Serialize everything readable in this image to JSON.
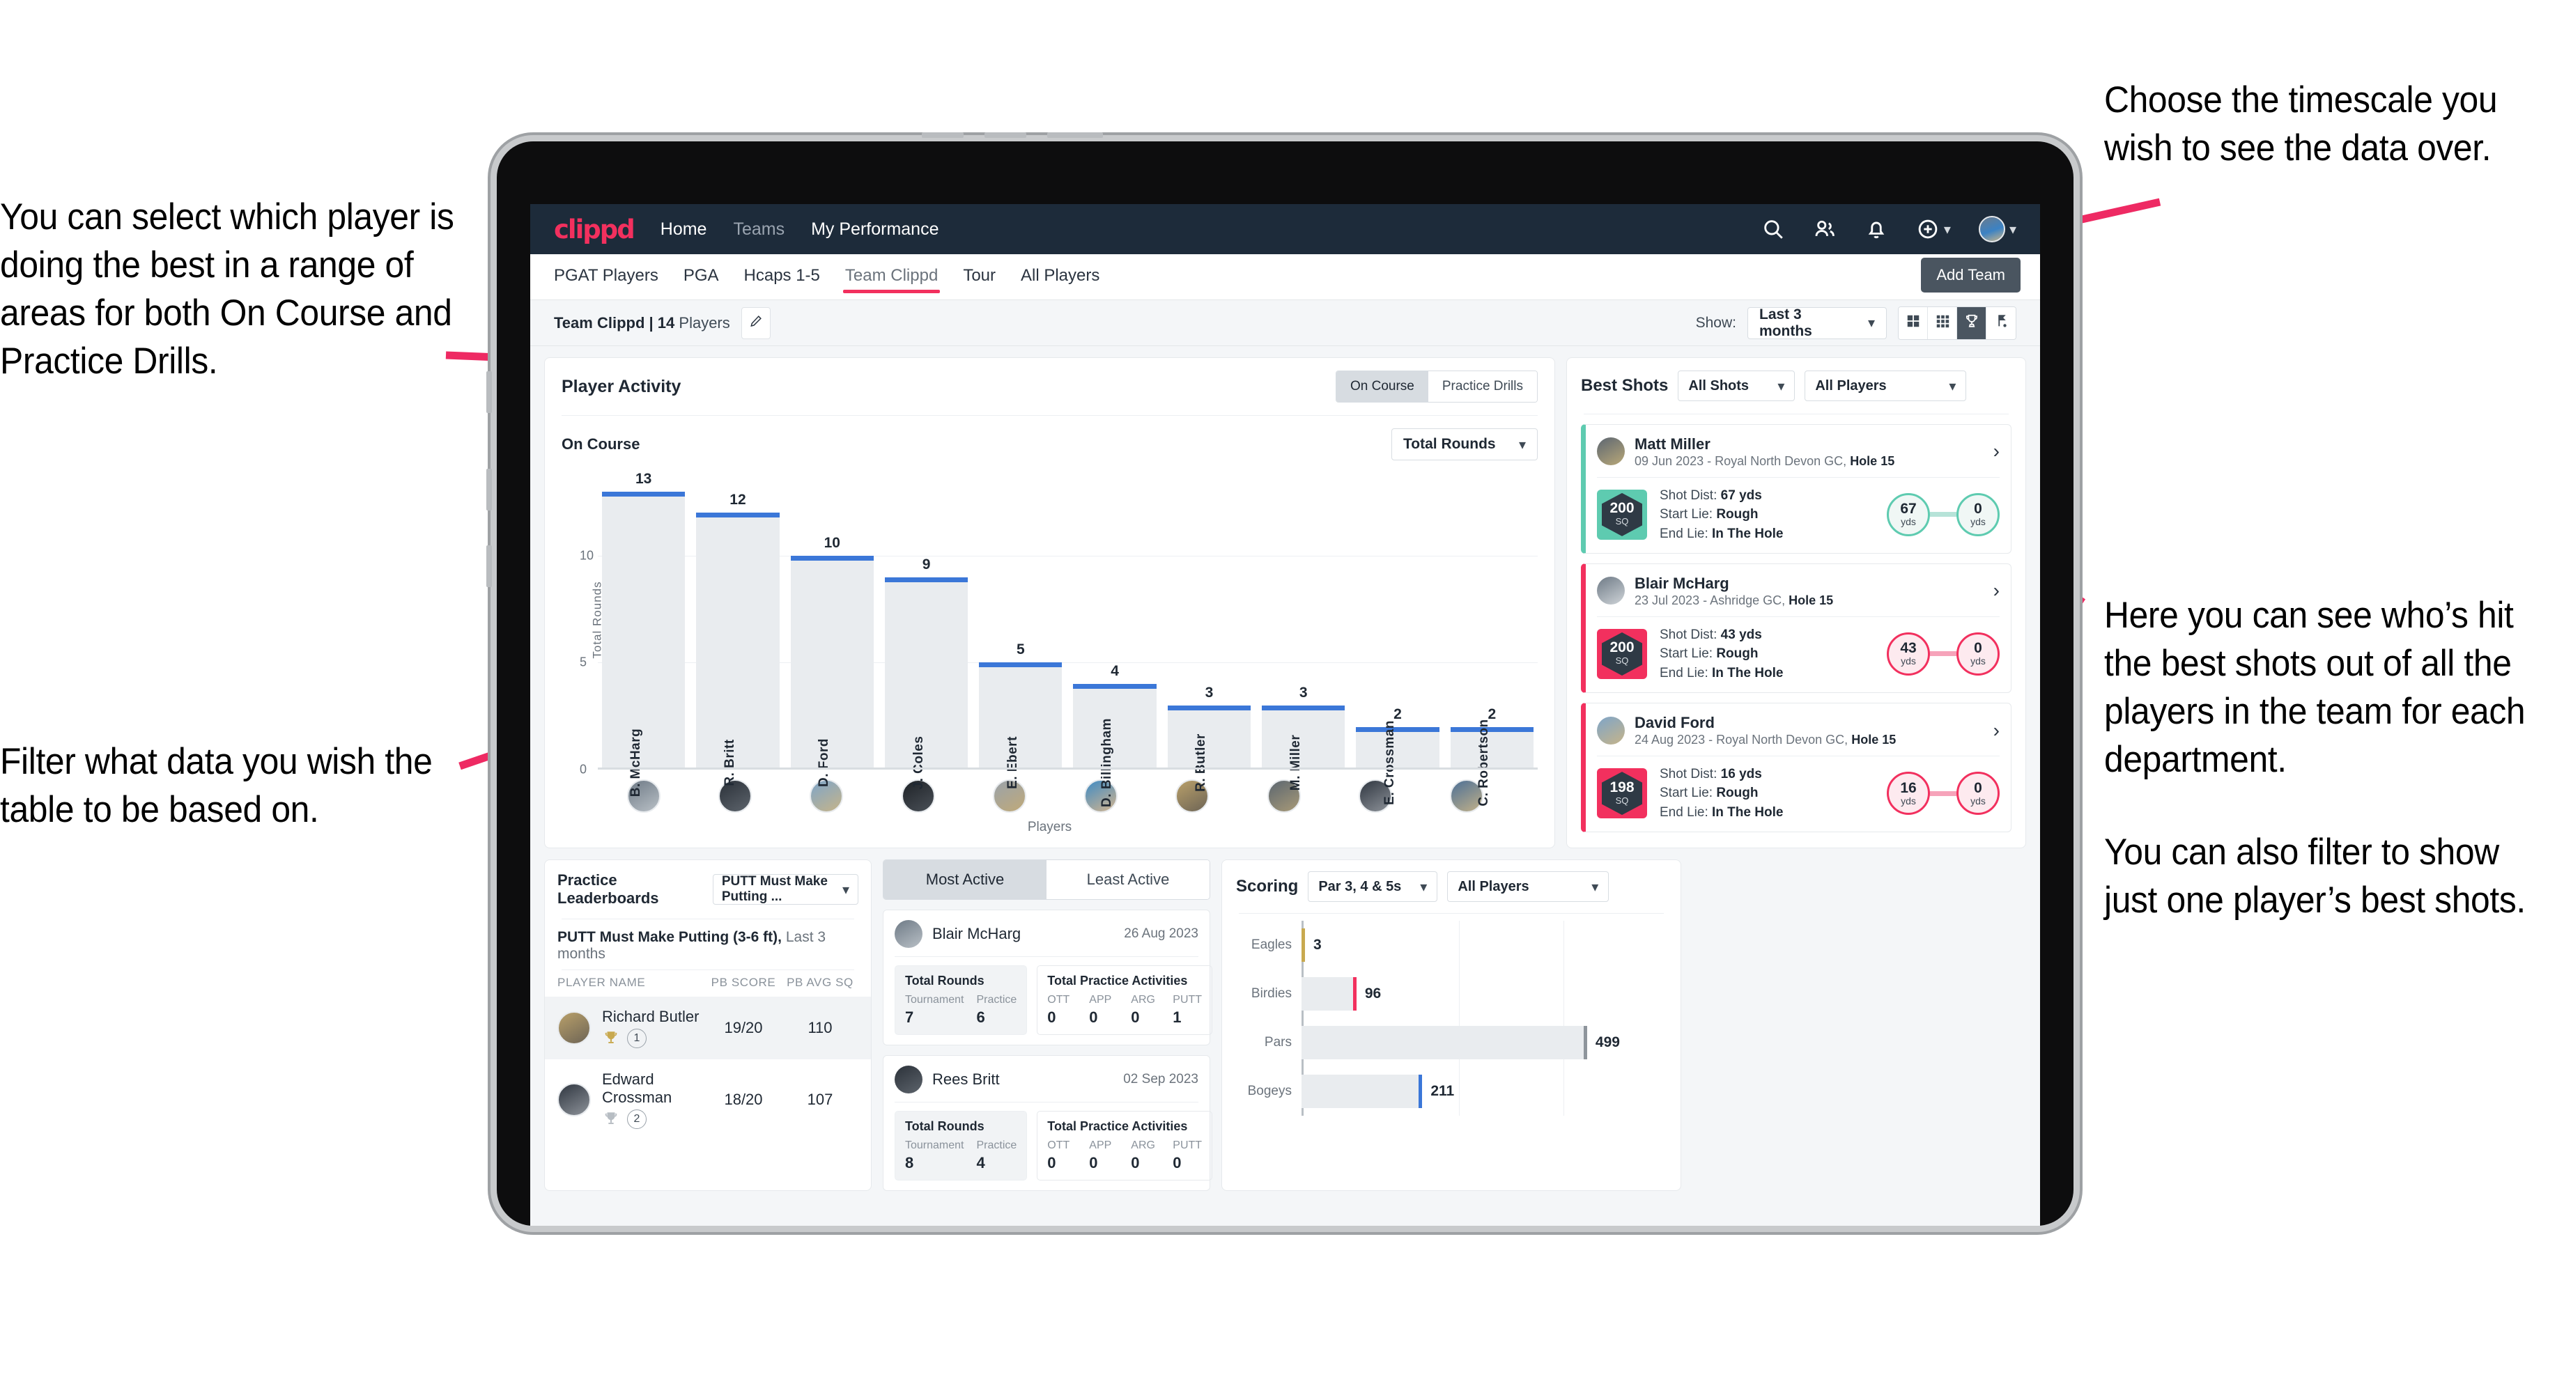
{
  "annotations": {
    "top_left": "You can select which player is doing the best in a range of areas for both On Course and Practice Drills.",
    "bottom_left": "Filter what data you wish the table to be based on.",
    "top_right": "Choose the timescale you wish to see the data over.",
    "mid_right": "Here you can see who’s hit the best shots out of all the players in the team for each department.",
    "mid_right_2": "You can also filter to show just one player’s best shots."
  },
  "topnav": {
    "brand": "clippd",
    "links": [
      {
        "label": "Home",
        "dim": false
      },
      {
        "label": "Teams",
        "dim": true
      },
      {
        "label": "My Performance",
        "dim": false
      }
    ],
    "icons": [
      "search-icon",
      "people-icon",
      "bell-icon",
      "plus-circle-icon",
      "avatar"
    ]
  },
  "subnav": {
    "tabs": [
      {
        "label": "PGAT Players",
        "active": false
      },
      {
        "label": "PGA",
        "active": false
      },
      {
        "label": "Hcaps 1-5",
        "active": false
      },
      {
        "label": "Team Clippd",
        "active": true
      },
      {
        "label": "Tour",
        "active": false
      },
      {
        "label": "All Players",
        "active": false
      }
    ],
    "tooltip": "Add Team"
  },
  "teambar": {
    "team_name": "Team Clippd",
    "separator": " | ",
    "player_count": "14",
    "players_word": "Players",
    "edit_icon": "pencil-icon",
    "show_label": "Show:",
    "timescale_value": "Last 3 months",
    "view_toggles": [
      {
        "icon": "grid-4-icon",
        "active": false
      },
      {
        "icon": "grid-9-icon",
        "active": false
      },
      {
        "icon": "trophy-icon",
        "active": true
      },
      {
        "icon": "golf-flag-icon",
        "active": false
      }
    ]
  },
  "player_activity": {
    "title": "Player Activity",
    "segments": [
      {
        "label": "On Course",
        "active": true
      },
      {
        "label": "Practice Drills",
        "active": false
      }
    ],
    "subtitle": "On Course",
    "metric_select": "Total Rounds"
  },
  "chart_data": [
    {
      "type": "bar",
      "title": "Player Activity — On Course",
      "xlabel": "Players",
      "ylabel": "Total Rounds",
      "categories": [
        "B. McHarg",
        "R. Britt",
        "D. Ford",
        "J. Coles",
        "E. Ebert",
        "D. Billingham",
        "R. Butler",
        "M. Miller",
        "E. Crossman",
        "C. Robertson"
      ],
      "values": [
        13,
        12,
        10,
        9,
        5,
        4,
        3,
        3,
        2,
        2
      ],
      "ylim": [
        0,
        14
      ],
      "yticks": [
        0,
        5,
        10
      ],
      "grid": true,
      "bar_color": "#e9ecef",
      "cap_color": "#3b77d8"
    },
    {
      "type": "bar",
      "orientation": "horizontal",
      "title": "Scoring",
      "categories": [
        "Eagles",
        "Birdies",
        "Pars",
        "Bogeys"
      ],
      "values": [
        3,
        96,
        499,
        211
      ],
      "cap_colors": [
        "#c8a94f",
        "#f2305e",
        "#8e959c",
        "#3b77d8"
      ],
      "xlim": [
        0,
        560
      ],
      "grid": true
    }
  ],
  "best_shots": {
    "title": "Best Shots",
    "filter_shots": "All Shots",
    "filter_players": "All Players",
    "cards": [
      {
        "player": "Matt Miller",
        "meta_date": "09 Jun 2023",
        "meta_course": "Royal North Devon GC,",
        "meta_hole": "Hole 15",
        "sq_value": "200",
        "sq_unit": "SQ",
        "accent": "teal",
        "shot_dist_label": "Shot Dist:",
        "shot_dist_value": "67 yds",
        "start_lie_label": "Start Lie:",
        "start_lie_value": "Rough",
        "end_lie_label": "End Lie:",
        "end_lie_value": "In The Hole",
        "from_value": "67",
        "from_unit": "yds",
        "to_value": "0",
        "to_unit": "yds"
      },
      {
        "player": "Blair McHarg",
        "meta_date": "23 Jul 2023",
        "meta_course": "Ashridge GC,",
        "meta_hole": "Hole 15",
        "sq_value": "200",
        "sq_unit": "SQ",
        "accent": "pink",
        "shot_dist_label": "Shot Dist:",
        "shot_dist_value": "43 yds",
        "start_lie_label": "Start Lie:",
        "start_lie_value": "Rough",
        "end_lie_label": "End Lie:",
        "end_lie_value": "In The Hole",
        "from_value": "43",
        "from_unit": "yds",
        "to_value": "0",
        "to_unit": "yds"
      },
      {
        "player": "David Ford",
        "meta_date": "24 Aug 2023",
        "meta_course": "Royal North Devon GC,",
        "meta_hole": "Hole 15",
        "sq_value": "198",
        "sq_unit": "SQ",
        "accent": "pink",
        "shot_dist_label": "Shot Dist:",
        "shot_dist_value": "16 yds",
        "start_lie_label": "Start Lie:",
        "start_lie_value": "Rough",
        "end_lie_label": "End Lie:",
        "end_lie_value": "In The Hole",
        "from_value": "16",
        "from_unit": "yds",
        "to_value": "0",
        "to_unit": "yds"
      }
    ]
  },
  "practice_leaderboards": {
    "title": "Practice Leaderboards",
    "drill_select": "PUTT Must Make Putting ...",
    "sub_bold": "PUTT Must Make Putting (3-6 ft),",
    "sub_light": "Last 3 months",
    "columns": [
      "PLAYER NAME",
      "PB SCORE",
      "PB AVG SQ"
    ],
    "rows": [
      {
        "name": "Richard Butler",
        "rank": "1",
        "trophy": "gold",
        "pb_score": "19/20",
        "pb_avg_sq": "110"
      },
      {
        "name": "Edward Crossman",
        "rank": "2",
        "trophy": "silver",
        "pb_score": "18/20",
        "pb_avg_sq": "107"
      }
    ]
  },
  "activity_panel": {
    "tabs": [
      {
        "label": "Most Active",
        "active": true
      },
      {
        "label": "Least Active",
        "active": false
      }
    ],
    "rounds_title": "Total Rounds",
    "practice_title": "Total Practice Activities",
    "rounds_keys": [
      "Tournament",
      "Practice"
    ],
    "practice_keys": [
      "OTT",
      "APP",
      "ARG",
      "PUTT"
    ],
    "cards": [
      {
        "name": "Blair McHarg",
        "date": "26 Aug 2023",
        "rounds": [
          "7",
          "6"
        ],
        "practice": [
          "0",
          "0",
          "0",
          "1"
        ]
      },
      {
        "name": "Rees Britt",
        "date": "02 Sep 2023",
        "rounds": [
          "8",
          "4"
        ],
        "practice": [
          "0",
          "0",
          "0",
          "0"
        ]
      }
    ]
  },
  "scoring": {
    "title": "Scoring",
    "filter_par": "Par 3, 4 & 5s",
    "filter_players": "All Players"
  },
  "colors": {
    "brand_pink": "#f2305e",
    "nav_dark": "#1d2b3a",
    "teal": "#5ecbb0",
    "blue": "#3b77d8",
    "gold": "#c8a94f"
  }
}
